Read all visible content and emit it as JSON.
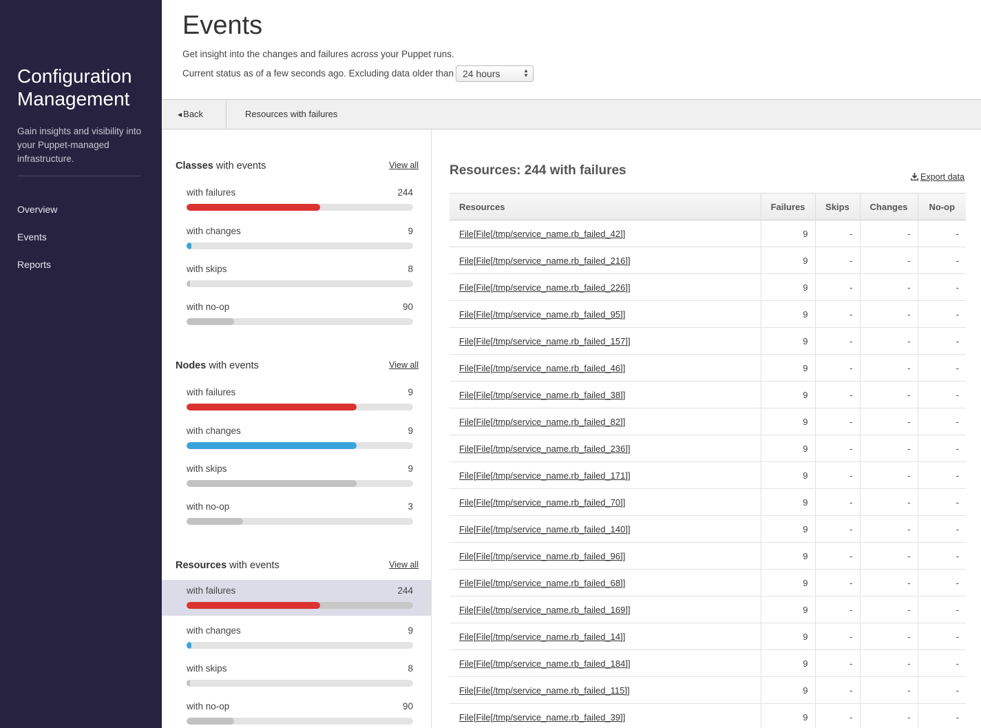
{
  "sidebar": {
    "app_title": "Configuration Management",
    "description": "Gain insights and visibility into your Puppet-managed infrastructure.",
    "nav": [
      {
        "label": "Overview"
      },
      {
        "label": "Events"
      },
      {
        "label": "Reports"
      }
    ]
  },
  "header": {
    "title": "Events",
    "subtitle": "Get insight into the changes and failures across your Puppet runs.",
    "status_text": "Current status as of a few seconds ago. Excluding data older than",
    "timeframe": "24 hours",
    "timeframe_arrows": "▲\n▼"
  },
  "breadcrumb": {
    "back_caret": "◀",
    "back_label": "Back",
    "current": "Resources with failures"
  },
  "summary": {
    "sections": [
      {
        "title_bold": "Classes",
        "title_rest": " with events",
        "view_all": "View all",
        "stats": [
          {
            "label": "with failures",
            "count": "244",
            "ratio": 0.59,
            "kind": "failures"
          },
          {
            "label": "with changes",
            "count": "9",
            "ratio": 0.02,
            "kind": "changes"
          },
          {
            "label": "with skips",
            "count": "8",
            "ratio": 0.01,
            "kind": "skips"
          },
          {
            "label": "with no-op",
            "count": "90",
            "ratio": 0.21,
            "kind": "noop"
          }
        ]
      },
      {
        "title_bold": "Nodes",
        "title_rest": " with events",
        "view_all": "View all",
        "stats": [
          {
            "label": "with failures",
            "count": "9",
            "ratio": 0.75,
            "kind": "failures"
          },
          {
            "label": "with changes",
            "count": "9",
            "ratio": 0.75,
            "kind": "changes"
          },
          {
            "label": "with skips",
            "count": "9",
            "ratio": 0.75,
            "kind": "skips"
          },
          {
            "label": "with no-op",
            "count": "3",
            "ratio": 0.25,
            "kind": "noop"
          }
        ]
      },
      {
        "title_bold": "Resources",
        "title_rest": " with events",
        "view_all": "View all",
        "stats": [
          {
            "label": "with failures",
            "count": "244",
            "ratio": 0.59,
            "kind": "failures",
            "selected": true
          },
          {
            "label": "with changes",
            "count": "9",
            "ratio": 0.02,
            "kind": "changes"
          },
          {
            "label": "with skips",
            "count": "8",
            "ratio": 0.01,
            "kind": "skips"
          },
          {
            "label": "with no-op",
            "count": "90",
            "ratio": 0.21,
            "kind": "noop"
          }
        ]
      }
    ]
  },
  "main": {
    "title_bold": "Resources:",
    "title_rest": " 244 with failures",
    "export_label": "Export data",
    "columns": [
      "Resources",
      "Failures",
      "Skips",
      "Changes",
      "No-op"
    ],
    "rows": [
      {
        "name": "File[File[/tmp/service_name.rb_failed_42]]",
        "failures": "9",
        "skips": "-",
        "changes": "-",
        "noop": "-"
      },
      {
        "name": "File[File[/tmp/service_name.rb_failed_216]]",
        "failures": "9",
        "skips": "-",
        "changes": "-",
        "noop": "-"
      },
      {
        "name": "File[File[/tmp/service_name.rb_failed_226]]",
        "failures": "9",
        "skips": "-",
        "changes": "-",
        "noop": "-"
      },
      {
        "name": "File[File[/tmp/service_name.rb_failed_95]]",
        "failures": "9",
        "skips": "-",
        "changes": "-",
        "noop": "-"
      },
      {
        "name": "File[File[/tmp/service_name.rb_failed_157]]",
        "failures": "9",
        "skips": "-",
        "changes": "-",
        "noop": "-"
      },
      {
        "name": "File[File[/tmp/service_name.rb_failed_46]]",
        "failures": "9",
        "skips": "-",
        "changes": "-",
        "noop": "-"
      },
      {
        "name": "File[File[/tmp/service_name.rb_failed_38]]",
        "failures": "9",
        "skips": "-",
        "changes": "-",
        "noop": "-"
      },
      {
        "name": "File[File[/tmp/service_name.rb_failed_82]]",
        "failures": "9",
        "skips": "-",
        "changes": "-",
        "noop": "-"
      },
      {
        "name": "File[File[/tmp/service_name.rb_failed_236]]",
        "failures": "9",
        "skips": "-",
        "changes": "-",
        "noop": "-"
      },
      {
        "name": "File[File[/tmp/service_name.rb_failed_171]]",
        "failures": "9",
        "skips": "-",
        "changes": "-",
        "noop": "-"
      },
      {
        "name": "File[File[/tmp/service_name.rb_failed_70]]",
        "failures": "9",
        "skips": "-",
        "changes": "-",
        "noop": "-"
      },
      {
        "name": "File[File[/tmp/service_name.rb_failed_140]]",
        "failures": "9",
        "skips": "-",
        "changes": "-",
        "noop": "-"
      },
      {
        "name": "File[File[/tmp/service_name.rb_failed_96]]",
        "failures": "9",
        "skips": "-",
        "changes": "-",
        "noop": "-"
      },
      {
        "name": "File[File[/tmp/service_name.rb_failed_68]]",
        "failures": "9",
        "skips": "-",
        "changes": "-",
        "noop": "-"
      },
      {
        "name": "File[File[/tmp/service_name.rb_failed_169]]",
        "failures": "9",
        "skips": "-",
        "changes": "-",
        "noop": "-"
      },
      {
        "name": "File[File[/tmp/service_name.rb_failed_14]]",
        "failures": "9",
        "skips": "-",
        "changes": "-",
        "noop": "-"
      },
      {
        "name": "File[File[/tmp/service_name.rb_failed_184]]",
        "failures": "9",
        "skips": "-",
        "changes": "-",
        "noop": "-"
      },
      {
        "name": "File[File[/tmp/service_name.rb_failed_115]]",
        "failures": "9",
        "skips": "-",
        "changes": "-",
        "noop": "-"
      },
      {
        "name": "File[File[/tmp/service_name.rb_failed_39]]",
        "failures": "9",
        "skips": "-",
        "changes": "-",
        "noop": "-"
      }
    ]
  }
}
